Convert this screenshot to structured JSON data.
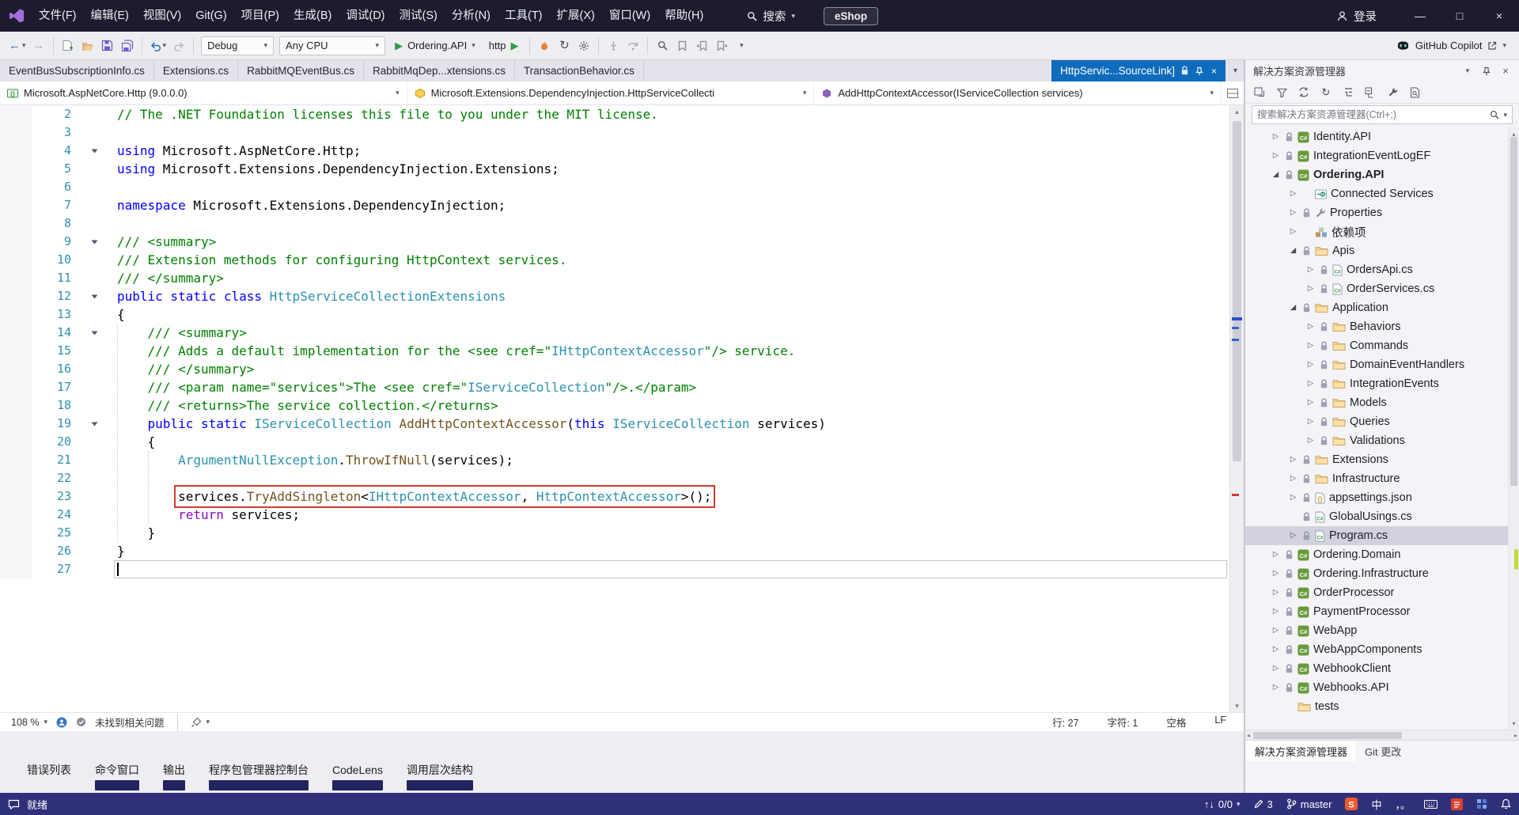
{
  "colors": {
    "accent_blue": "#0f6cbd",
    "highlight_red": "#d23b2e",
    "status_bar": "#30307a",
    "title_bar": "#1c1c2e",
    "line_number": "#2b91af"
  },
  "icons": {
    "caret": "▾",
    "play": "▶",
    "back": "←",
    "forward": "→",
    "refresh": "↻",
    "minimize": "—",
    "maximize": "□",
    "close": "×",
    "sync": "↑↓",
    "chev_r": "▷",
    "chev_d": "◢",
    "left": "◂",
    "right": "▸",
    "up": "▴",
    "down": "▾"
  },
  "title_bar": {
    "menus": [
      "文件(F)",
      "编辑(E)",
      "视图(V)",
      "Git(G)",
      "项目(P)",
      "生成(B)",
      "调试(D)",
      "测试(S)",
      "分析(N)",
      "工具(T)",
      "扩展(X)",
      "窗口(W)",
      "帮助(H)"
    ],
    "search_label": "搜索",
    "solution_badge": "eShop",
    "sign_in_label": "登录"
  },
  "toolbar": {
    "configuration": "Debug",
    "platform": "Any CPU",
    "startup_project": "Ordering.API",
    "launch_profile": "http",
    "copilot_label": "GitHub Copilot"
  },
  "editor_tabs": {
    "tabs": [
      {
        "label": "EventBusSubscriptionInfo.cs",
        "active": false
      },
      {
        "label": "Extensions.cs",
        "active": false
      },
      {
        "label": "RabbitMQEventBus.cs",
        "active": false
      },
      {
        "label": "RabbitMqDep...xtensions.cs",
        "active": false
      },
      {
        "label": "TransactionBehavior.cs",
        "active": false
      },
      {
        "label": "HttpServic...SourceLink]",
        "active": true,
        "readonly": true,
        "pinned": true
      }
    ]
  },
  "breadcrumbs": [
    {
      "icon": "assembly-icon",
      "label": "Microsoft.AspNetCore.Http (9.0.0.0)"
    },
    {
      "icon": "class-icon",
      "label": "Microsoft.Extensions.DependencyInjection.HttpServiceCollecti"
    },
    {
      "icon": "method-icon",
      "label": "AddHttpContextAccessor(IServiceCollection services)"
    }
  ],
  "editor": {
    "lines": [
      {
        "n": 2,
        "segs": [
          [
            "c",
            "// The .NET Foundation licenses this file to you under the MIT license."
          ]
        ]
      },
      {
        "n": 3,
        "segs": []
      },
      {
        "n": 4,
        "fold": true,
        "segs": [
          [
            "k",
            "using"
          ],
          [
            "p",
            " Microsoft.AspNetCore.Http;"
          ]
        ]
      },
      {
        "n": 5,
        "segs": [
          [
            "k",
            "using"
          ],
          [
            "p",
            " Microsoft.Extensions.DependencyInjection.Extensions;"
          ]
        ]
      },
      {
        "n": 6,
        "segs": []
      },
      {
        "n": 7,
        "segs": [
          [
            "k",
            "namespace"
          ],
          [
            "p",
            " Microsoft.Extensions.DependencyInjection;"
          ]
        ]
      },
      {
        "n": 8,
        "segs": []
      },
      {
        "n": 9,
        "fold": true,
        "segs": [
          [
            "d",
            "/// <summary>"
          ]
        ]
      },
      {
        "n": 10,
        "segs": [
          [
            "d",
            "/// Extension methods for configuring HttpContext services."
          ]
        ]
      },
      {
        "n": 11,
        "segs": [
          [
            "d",
            "/// </summary>"
          ]
        ]
      },
      {
        "n": 12,
        "fold": true,
        "segs": [
          [
            "k",
            "public static class"
          ],
          [
            "p",
            " "
          ],
          [
            "t",
            "HttpServiceCollectionExtensions"
          ]
        ]
      },
      {
        "n": 13,
        "segs": [
          [
            "p",
            "{"
          ]
        ]
      },
      {
        "n": 14,
        "fold": true,
        "guides": [
          0
        ],
        "segs": [
          [
            "d",
            "    /// <summary>"
          ]
        ]
      },
      {
        "n": 15,
        "guides": [
          0
        ],
        "segs": [
          [
            "d",
            "    /// Adds a default implementation for the <see cref=\""
          ],
          [
            "dc",
            "IHttpContextAccessor"
          ],
          [
            "d",
            "\"/> service."
          ]
        ]
      },
      {
        "n": 16,
        "guides": [
          0
        ],
        "segs": [
          [
            "d",
            "    /// </summary>"
          ]
        ]
      },
      {
        "n": 17,
        "guides": [
          0
        ],
        "segs": [
          [
            "d",
            "    /// <param name=\"services\">The <see cref=\""
          ],
          [
            "dc",
            "IServiceCollection"
          ],
          [
            "d",
            "\"/>.</param>"
          ]
        ]
      },
      {
        "n": 18,
        "guides": [
          0
        ],
        "segs": [
          [
            "d",
            "    /// <returns>The service collection.</returns>"
          ]
        ]
      },
      {
        "n": 19,
        "fold": true,
        "guides": [
          0
        ],
        "segs": [
          [
            "p",
            "    "
          ],
          [
            "k",
            "public static"
          ],
          [
            "p",
            " "
          ],
          [
            "t",
            "IServiceCollection"
          ],
          [
            "p",
            " "
          ],
          [
            "m",
            "AddHttpContextAccessor"
          ],
          [
            "p",
            "("
          ],
          [
            "k",
            "this"
          ],
          [
            "p",
            " "
          ],
          [
            "t",
            "IServiceCollection"
          ],
          [
            "p",
            " services)"
          ]
        ]
      },
      {
        "n": 20,
        "guides": [
          0
        ],
        "segs": [
          [
            "p",
            "    {"
          ]
        ]
      },
      {
        "n": 21,
        "guides": [
          0,
          4
        ],
        "segs": [
          [
            "p",
            "        "
          ],
          [
            "t",
            "ArgumentNullException"
          ],
          [
            "p",
            "."
          ],
          [
            "m",
            "ThrowIfNull"
          ],
          [
            "p",
            "(services);"
          ]
        ]
      },
      {
        "n": 22,
        "guides": [
          0,
          4
        ],
        "segs": []
      },
      {
        "n": 23,
        "guides": [
          0,
          4
        ],
        "box": true,
        "indent": "        ",
        "segs": [
          [
            "p",
            "services."
          ],
          [
            "m",
            "TryAddSingleton"
          ],
          [
            "p",
            "<"
          ],
          [
            "t",
            "IHttpContextAccessor"
          ],
          [
            "p",
            ", "
          ],
          [
            "t",
            "HttpContextAccessor"
          ],
          [
            "p",
            ">();"
          ]
        ]
      },
      {
        "n": 24,
        "guides": [
          0,
          4
        ],
        "segs": [
          [
            "p",
            "        "
          ],
          [
            "ct",
            "return"
          ],
          [
            "p",
            " services;"
          ]
        ]
      },
      {
        "n": 25,
        "guides": [
          0
        ],
        "segs": [
          [
            "p",
            "    }"
          ]
        ]
      },
      {
        "n": 26,
        "segs": [
          [
            "p",
            "}"
          ]
        ]
      },
      {
        "n": 27,
        "current": true,
        "cursor": true,
        "segs": []
      }
    ],
    "status": {
      "zoom": "108 %",
      "health": "未找到相关问题",
      "line": "行: 27",
      "column": "字符: 1",
      "spaces": "空格",
      "line_ending": "LF"
    }
  },
  "panel_tabs": [
    "错误列表",
    "命令窗口",
    "输出",
    "程序包管理器控制台",
    "CodeLens",
    "调用层次结构"
  ],
  "solution_explorer": {
    "title": "解决方案资源管理器",
    "search_placeholder": "搜索解决方案资源管理器(Ctrl+;)",
    "tree": [
      {
        "d": 1,
        "a": "r",
        "lock": true,
        "i": "project",
        "label": "Identity.API"
      },
      {
        "d": 1,
        "a": "r",
        "lock": true,
        "i": "project",
        "label": "IntegrationEventLogEF"
      },
      {
        "d": 1,
        "a": "d",
        "lock": true,
        "i": "project",
        "label": "Ordering.API",
        "bold": true
      },
      {
        "d": 2,
        "a": "r",
        "lock": false,
        "i": "services",
        "label": "Connected Services"
      },
      {
        "d": 2,
        "a": "r",
        "lock": true,
        "i": "properties",
        "label": "Properties"
      },
      {
        "d": 2,
        "a": "r",
        "lock": false,
        "i": "deps",
        "label": "依赖项"
      },
      {
        "d": 2,
        "a": "d",
        "lock": true,
        "i": "folder",
        "label": "Apis"
      },
      {
        "d": 3,
        "a": "r",
        "lock": true,
        "i": "csfile",
        "label": "OrdersApi.cs"
      },
      {
        "d": 3,
        "a": "r",
        "lock": true,
        "i": "csfile",
        "label": "OrderServices.cs"
      },
      {
        "d": 2,
        "a": "d",
        "lock": true,
        "i": "folder",
        "label": "Application"
      },
      {
        "d": 3,
        "a": "r",
        "lock": true,
        "i": "folder",
        "label": "Behaviors"
      },
      {
        "d": 3,
        "a": "r",
        "lock": true,
        "i": "folder",
        "label": "Commands"
      },
      {
        "d": 3,
        "a": "r",
        "lock": true,
        "i": "folder",
        "label": "DomainEventHandlers"
      },
      {
        "d": 3,
        "a": "r",
        "lock": true,
        "i": "folder",
        "label": "IntegrationEvents"
      },
      {
        "d": 3,
        "a": "r",
        "lock": true,
        "i": "folder",
        "label": "Models"
      },
      {
        "d": 3,
        "a": "r",
        "lock": true,
        "i": "folder",
        "label": "Queries"
      },
      {
        "d": 3,
        "a": "r",
        "lock": true,
        "i": "folder",
        "label": "Validations"
      },
      {
        "d": 2,
        "a": "r",
        "lock": true,
        "i": "folder",
        "label": "Extensions"
      },
      {
        "d": 2,
        "a": "r",
        "lock": true,
        "i": "folder",
        "label": "Infrastructure"
      },
      {
        "d": 2,
        "a": "r",
        "lock": true,
        "i": "json",
        "label": "appsettings.json"
      },
      {
        "d": 2,
        "a": "",
        "lock": true,
        "i": "csfile",
        "label": "GlobalUsings.cs"
      },
      {
        "d": 2,
        "a": "r",
        "lock": true,
        "i": "csfile",
        "label": "Program.cs",
        "sel": true
      },
      {
        "d": 1,
        "a": "r",
        "lock": true,
        "i": "project",
        "label": "Ordering.Domain"
      },
      {
        "d": 1,
        "a": "r",
        "lock": true,
        "i": "project",
        "label": "Ordering.Infrastructure"
      },
      {
        "d": 1,
        "a": "r",
        "lock": true,
        "i": "project",
        "label": "OrderProcessor"
      },
      {
        "d": 1,
        "a": "r",
        "lock": true,
        "i": "project",
        "label": "PaymentProcessor"
      },
      {
        "d": 1,
        "a": "r",
        "lock": true,
        "i": "project",
        "label": "WebApp"
      },
      {
        "d": 1,
        "a": "r",
        "lock": true,
        "i": "project",
        "label": "WebAppComponents"
      },
      {
        "d": 1,
        "a": "r",
        "lock": true,
        "i": "project",
        "label": "WebhookClient"
      },
      {
        "d": 1,
        "a": "r",
        "lock": true,
        "i": "project",
        "label": "Webhooks.API"
      },
      {
        "d": 1,
        "a": "",
        "lock": false,
        "i": "folder",
        "label": "tests"
      }
    ],
    "bottom_tabs": [
      {
        "label": "解决方案资源管理器",
        "active": true
      },
      {
        "label": "Git 更改",
        "active": false
      }
    ]
  },
  "status_bar": {
    "ready": "就绪",
    "sync_count": "0/0",
    "pending_edits": "3",
    "branch": "master",
    "ime_mode": "中",
    "ime_punct": "，。"
  }
}
